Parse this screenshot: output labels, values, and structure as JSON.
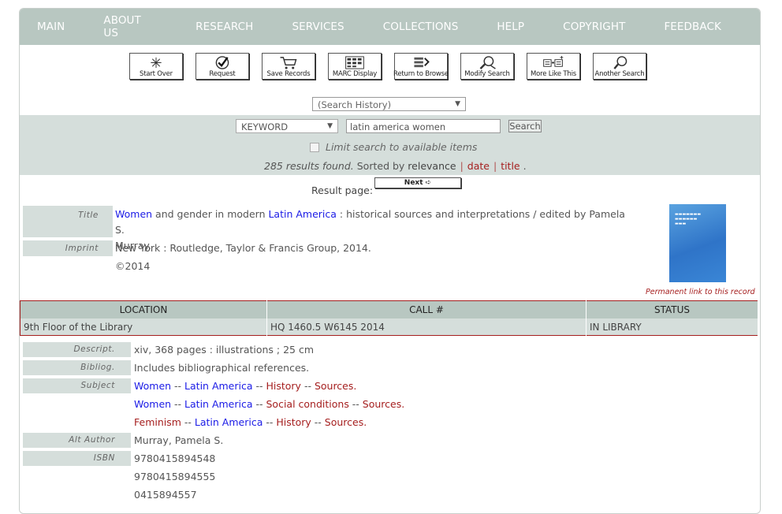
{
  "nav": [
    "MAIN",
    "ABOUT US",
    "RESEARCH",
    "SERVICES",
    "COLLECTIONS",
    "HELP",
    "COPYRIGHT",
    "FEEDBACK"
  ],
  "toolbar": [
    {
      "label": "Start Over",
      "icon": "star-burst-icon"
    },
    {
      "label": "Request",
      "icon": "checkmark-icon"
    },
    {
      "label": "Save Records",
      "icon": "cart-icon"
    },
    {
      "label": "MARC Display",
      "icon": "marc-icon"
    },
    {
      "label": "Return to Browse",
      "icon": "browse-icon"
    },
    {
      "label": "Modify Search",
      "icon": "modify-search-icon"
    },
    {
      "label": "More Like This",
      "icon": "more-like-icon"
    },
    {
      "label": "Another Search",
      "icon": "magnifier-icon"
    }
  ],
  "search": {
    "history": "(Search History)",
    "type": "KEYWORD",
    "query": "latin america women",
    "button": "Search",
    "limit": "Limit search to available items",
    "results_count": "285 results found.",
    "sorted_by": "Sorted by",
    "sort_relevance": "relevance",
    "sort_date": "date",
    "sort_title": "title",
    "sort_end": ".",
    "result_page": "Result page:",
    "next": "Next"
  },
  "record": {
    "title_label": "Title",
    "title_w1": "Women",
    "title_mid": " and gender in modern ",
    "title_w2": "Latin America",
    "title_rest1": " : historical sources and interpretations / edited by Pamela S.",
    "title_rest2": "Murray.",
    "imprint_label": "Imprint",
    "imprint": "New York : Routledge, Taylor & Francis Group, 2014.",
    "copyright": "©2014",
    "permalink": "Permanent link to this record"
  },
  "holdings": {
    "headers": [
      "LOCATION",
      "CALL #",
      "STATUS"
    ],
    "row": [
      "9th Floor of the Library",
      "HQ 1460.5 W6145 2014",
      "IN LIBRARY"
    ]
  },
  "details": {
    "descript_label": "Descript.",
    "descript": "xiv, 368 pages : illustrations ; 25 cm",
    "bibliog_label": "Bibliog.",
    "bibliog": "Includes bibliographical references.",
    "subject_label": "Subject",
    "subjects": [
      {
        "a": "Women",
        "b": "Latin America",
        "c": "History",
        "d": "Sources."
      },
      {
        "a": "Women",
        "b": "Latin America",
        "c": "Social conditions",
        "d": "Sources."
      },
      {
        "a": "Feminism",
        "b": "Latin America",
        "c": "History",
        "d": "Sources."
      }
    ],
    "sep": " -- ",
    "altauthor_label": "Alt Author",
    "altauthor": "Murray, Pamela S.",
    "isbn_label": "ISBN",
    "isbns": [
      "9780415894548",
      "9780415894555",
      "0415894557"
    ]
  }
}
